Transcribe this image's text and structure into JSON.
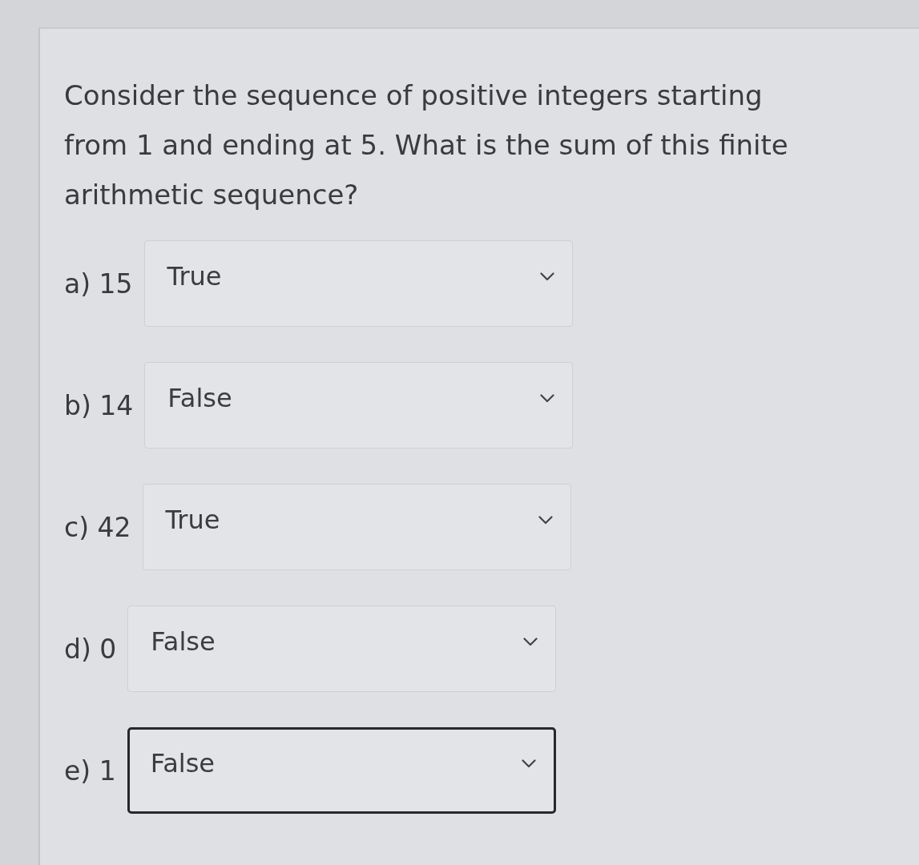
{
  "question": "Consider the sequence of positive integers starting from 1 and ending at 5. What is the sum of this finite arithmetic sequence?",
  "options": [
    {
      "label": "a) 15",
      "value": "True",
      "focused": false
    },
    {
      "label": "b) 14",
      "value": "False",
      "focused": false
    },
    {
      "label": "c) 42",
      "value": "True",
      "focused": false
    },
    {
      "label": "d) 0",
      "value": "False",
      "focused": false
    },
    {
      "label": "e) 1",
      "value": "False",
      "focused": true
    }
  ]
}
